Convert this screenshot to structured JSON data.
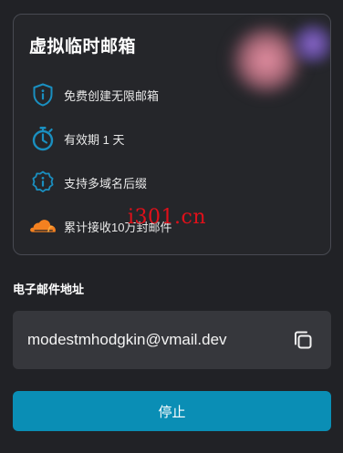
{
  "card": {
    "title": "虚拟临时邮箱",
    "features": [
      {
        "icon": "shield-info-icon",
        "label": "免费创建无限邮箱"
      },
      {
        "icon": "stopwatch-icon",
        "label": "有效期 1 天"
      },
      {
        "icon": "info-badge-icon",
        "label": "支持多域名后缀"
      },
      {
        "icon": "cloudflare-cloud-icon",
        "label": "累计接收10万封邮件"
      }
    ]
  },
  "watermark": "i301.cn",
  "email": {
    "section_label": "电子邮件地址",
    "address": "modestmhodgkin@vmail.dev",
    "copy_icon": "copy-icon"
  },
  "actions": {
    "stop_label": "停止"
  },
  "colors": {
    "accent": "#0a8eb5",
    "icon_blue": "#1a8fc0",
    "cloud_orange": "#f48120",
    "watermark_red": "#e0101a"
  }
}
